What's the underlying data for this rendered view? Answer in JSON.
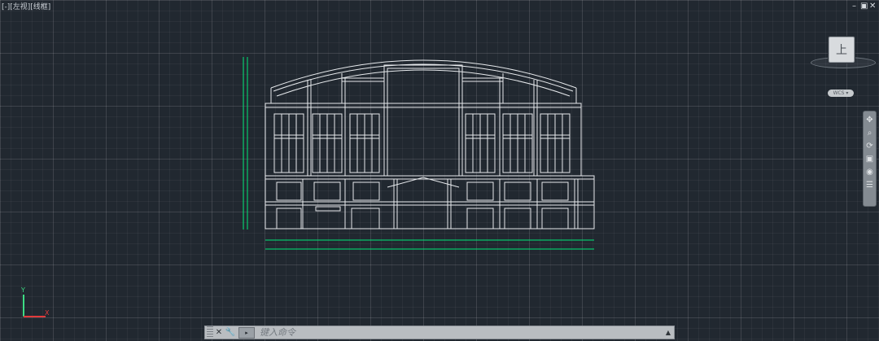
{
  "viewport": {
    "label": "[-][左视][线框]"
  },
  "window_controls": {
    "minimize": "–",
    "restore": "▣",
    "close": "✕"
  },
  "viewcube": {
    "face_label": "上",
    "wcs_label": "WCS ▾"
  },
  "ucs": {
    "y_label": "Y",
    "x_label": "X"
  },
  "navbar": {
    "icons": [
      "pan-icon",
      "zoom-icon",
      "orbit-icon",
      "showmotion-icon",
      "wheel-icon"
    ]
  },
  "command_line": {
    "placeholder": "键入命令",
    "close_icon": "✕",
    "settings_icon": "🔧",
    "prompt_icon": "▸",
    "expand_icon": "▲"
  },
  "colors": {
    "background": "#212830",
    "lines": "#e6e9ec",
    "dimension": "#00e676",
    "ucs_y": "#3ddc84",
    "ucs_x": "#e23b3b"
  }
}
